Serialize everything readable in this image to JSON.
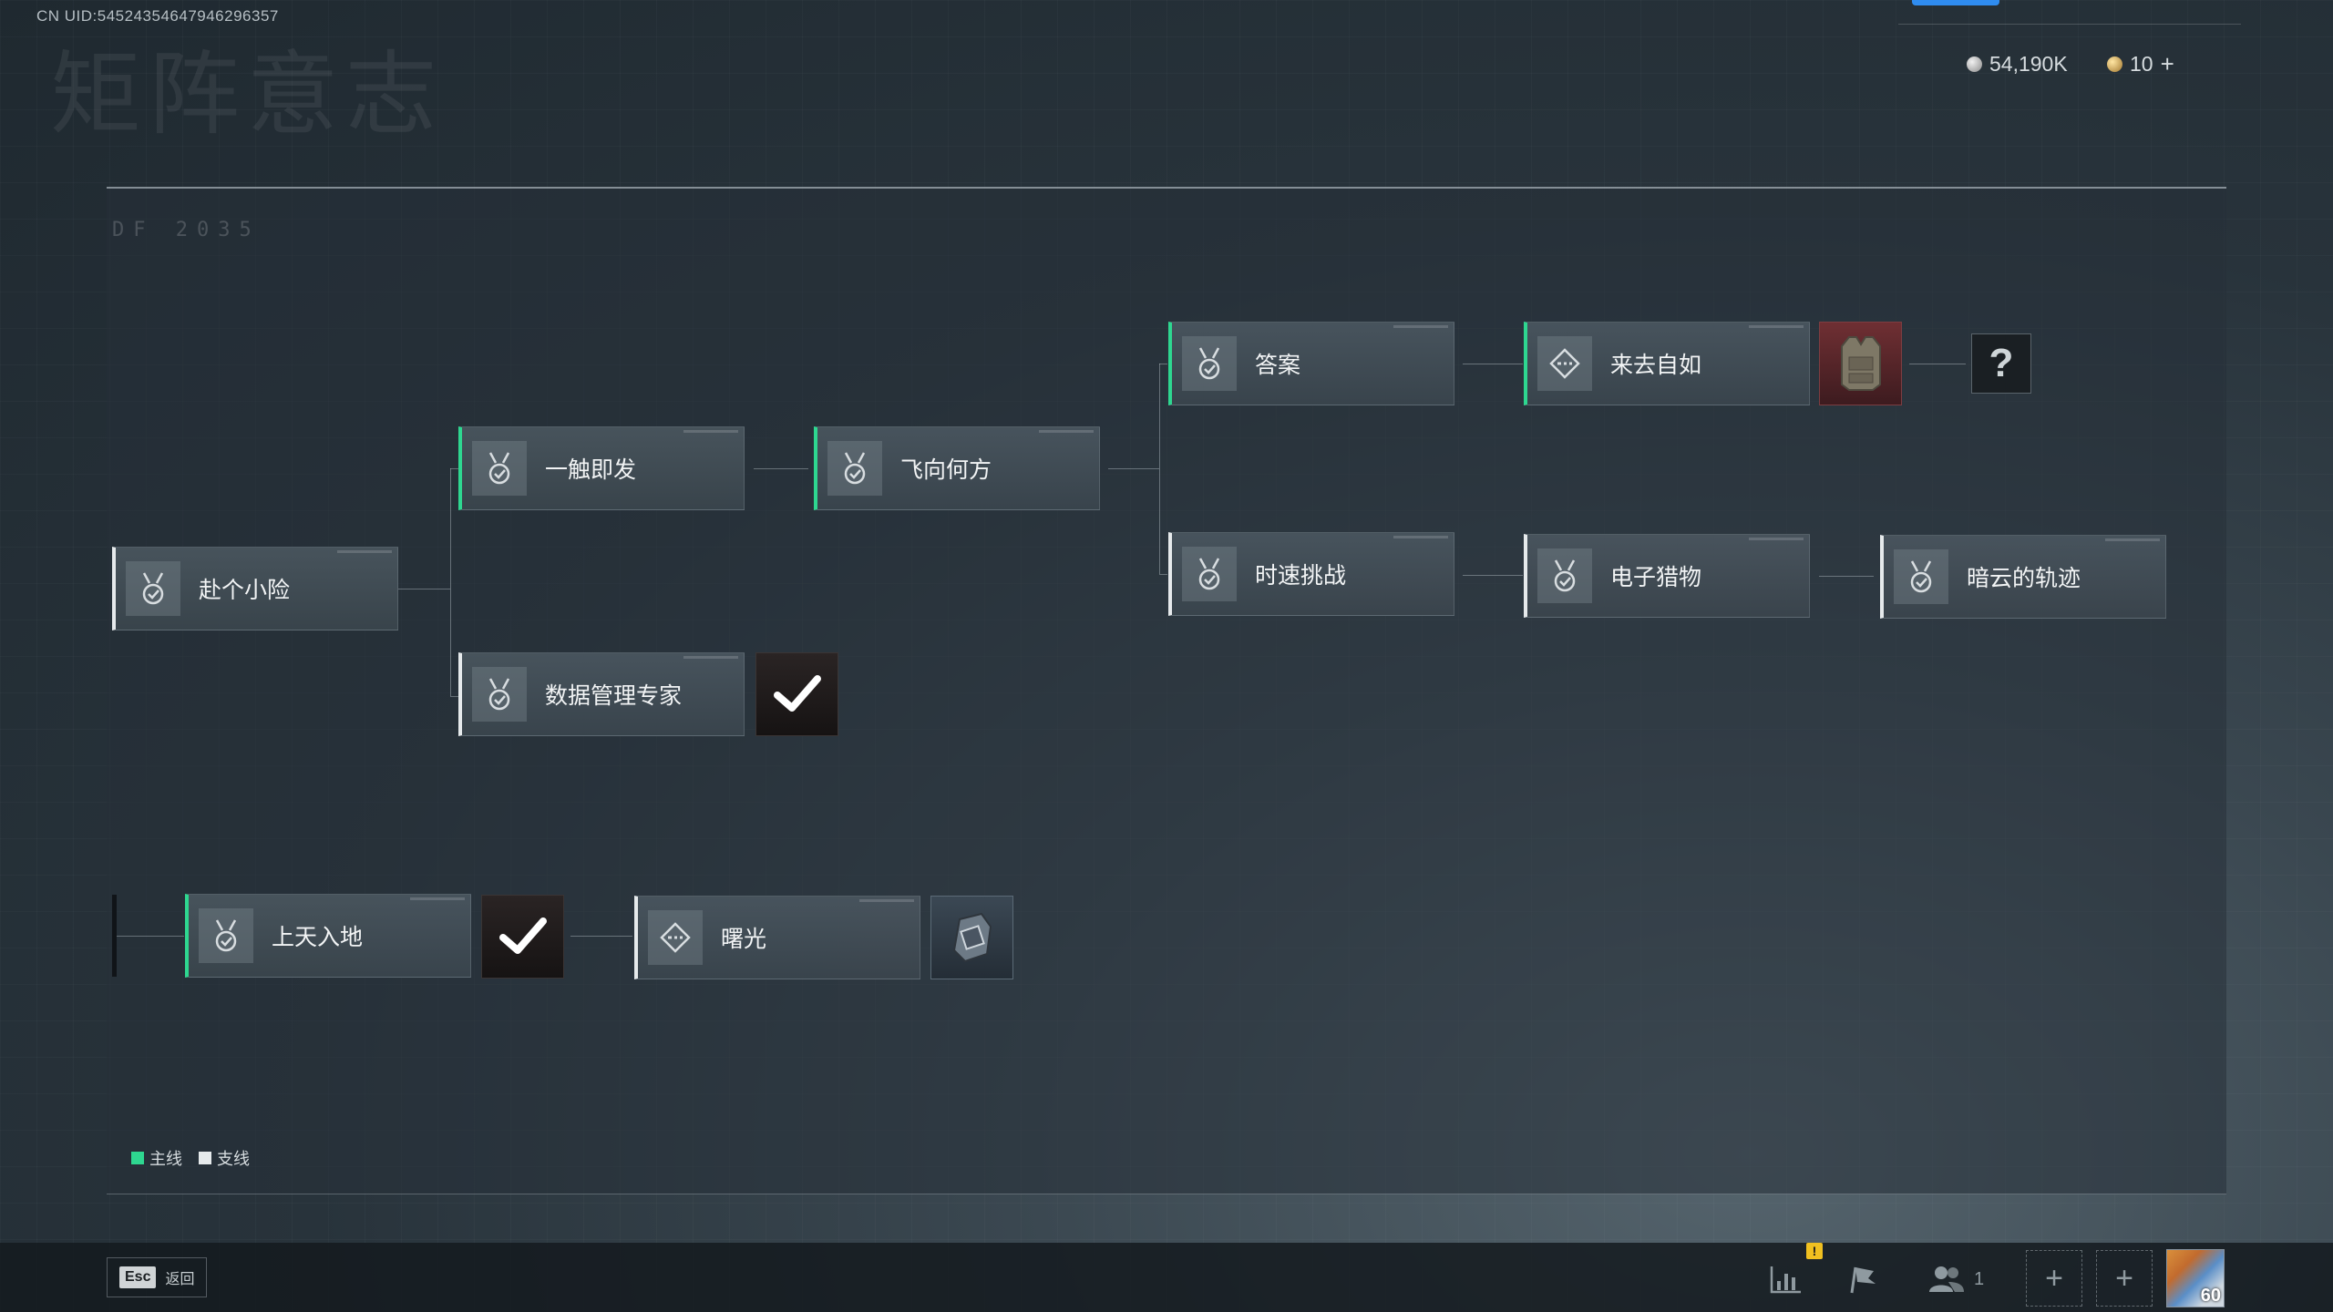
{
  "header": {
    "uid": "CN UID:54524354647946296357",
    "title_watermark": "矩阵意志",
    "currency_silver": "54,190K",
    "currency_gold": "10"
  },
  "panel": {
    "deco_code": "DF 2035"
  },
  "missions": [
    {
      "id": "n1",
      "label": "赴个小险",
      "line": "side"
    },
    {
      "id": "n2",
      "label": "一触即发",
      "line": "main"
    },
    {
      "id": "n3",
      "label": "飞向何方",
      "line": "main"
    },
    {
      "id": "n4",
      "label": "数据管理专家",
      "line": "side"
    },
    {
      "id": "n5",
      "label": "答案",
      "line": "main"
    },
    {
      "id": "n6",
      "label": "来去自如",
      "line": "main"
    },
    {
      "id": "n7",
      "label": "时速挑战",
      "line": "side"
    },
    {
      "id": "n8",
      "label": "电子猎物",
      "line": "side"
    },
    {
      "id": "n9",
      "label": "暗云的轨迹",
      "line": "side"
    },
    {
      "id": "n10",
      "label": "上天入地",
      "line": "main"
    },
    {
      "id": "n11",
      "label": "曙光",
      "line": "side"
    }
  ],
  "unknown_reward": "?",
  "legend": {
    "main_label": "主线",
    "side_label": "支线",
    "main_color": "#2ed790",
    "side_color": "#e6eaec"
  },
  "footer": {
    "esc_key": "Esc",
    "back_label": "返回",
    "warning_badge": "!",
    "friend_count": "1",
    "level": "60"
  }
}
